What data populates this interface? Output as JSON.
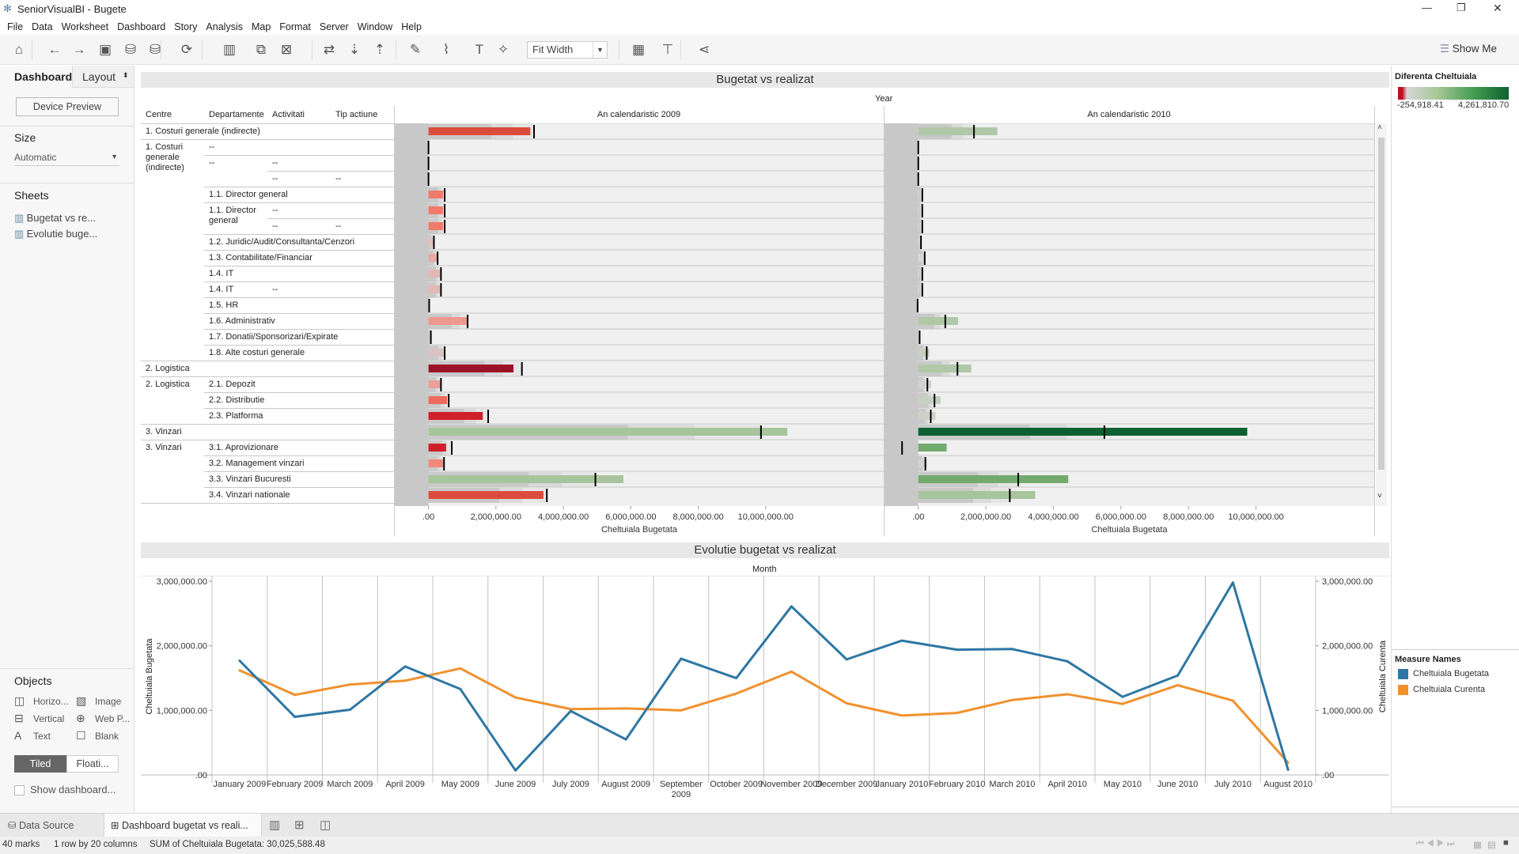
{
  "window": {
    "title": "SeniorVisualBI - Bugete",
    "controls": [
      "—",
      "❐",
      "✕"
    ]
  },
  "menu": [
    "File",
    "Data",
    "Worksheet",
    "Dashboard",
    "Story",
    "Analysis",
    "Map",
    "Format",
    "Server",
    "Window",
    "Help"
  ],
  "toolbar": {
    "icons": [
      {
        "name": "home-icon",
        "glyph": "⌂"
      },
      {
        "name": "undo-icon",
        "glyph": "←"
      },
      {
        "name": "redo-icon",
        "glyph": "→"
      },
      {
        "name": "save-icon",
        "glyph": "▣"
      },
      {
        "name": "new-datasource-icon",
        "glyph": "⛁"
      },
      {
        "name": "pause-updates-icon",
        "glyph": "⛁"
      },
      {
        "name": "refresh-icon",
        "glyph": "⟳"
      },
      {
        "name": "new-worksheet-icon",
        "glyph": "▥"
      },
      {
        "name": "duplicate-sheet-icon",
        "glyph": "⧉"
      },
      {
        "name": "clear-sheet-icon",
        "glyph": "⊠"
      },
      {
        "name": "swap-icon",
        "glyph": "⇄"
      },
      {
        "name": "sort-ascending-icon",
        "glyph": "⇣"
      },
      {
        "name": "sort-descending-icon",
        "glyph": "⇡"
      },
      {
        "name": "highlight-icon",
        "glyph": "✎"
      },
      {
        "name": "group-icon",
        "glyph": "⌇"
      },
      {
        "name": "labels-icon",
        "glyph": "T"
      },
      {
        "name": "pin-icon",
        "glyph": "✧"
      },
      {
        "name": "show-cards-icon",
        "glyph": "▦"
      },
      {
        "name": "presentation-icon",
        "glyph": "⊤"
      },
      {
        "name": "share-icon",
        "glyph": "⋖"
      }
    ],
    "fit": "Fit Width",
    "show_me": "Show Me"
  },
  "left_pane": {
    "tabs": [
      "Dashboard",
      "Layout"
    ],
    "device_preview": "Device Preview",
    "size_label": "Size",
    "size_value": "Automatic",
    "sheets_label": "Sheets",
    "sheets": [
      "Bugetat vs re...",
      "Evolutie buge..."
    ],
    "objects_label": "Objects",
    "objects": [
      {
        "icon": "horizontal-icon",
        "glyph": "◫",
        "label": "Horizo..."
      },
      {
        "icon": "image-icon",
        "glyph": "▨",
        "label": "Image"
      },
      {
        "icon": "vertical-icon",
        "glyph": "⊟",
        "label": "Vertical"
      },
      {
        "icon": "web-page-icon",
        "glyph": "⊕",
        "label": "Web P..."
      },
      {
        "icon": "text-icon",
        "glyph": "A",
        "label": "Text"
      },
      {
        "icon": "blank-icon",
        "glyph": "☐",
        "label": "Blank"
      }
    ],
    "tiled": "Tiled",
    "floating": "Floati...",
    "show_dashboard": "Show dashboard..."
  },
  "sheet1": {
    "title": "Bugetat vs realizat",
    "year_label": "Year",
    "headers": [
      "Centre",
      "Departamente",
      "Activitati",
      "Tip actiune"
    ],
    "years": [
      "An calendaristic 2009",
      "An calendaristic 2010"
    ],
    "axis_title": "Cheltuiala Bugetata",
    "ticks": [
      ".00",
      "2,000,000.00",
      "4,000,000.00",
      "6,000,000.00",
      "8,000,000.00",
      "10,000,000.00"
    ]
  },
  "chart_data": [
    {
      "type": "bar",
      "subtype": "bullet",
      "title": "Bugetat vs realizat",
      "xlabel": "Cheltuiala Bugetata",
      "xlim": [
        -1000000,
        13500000
      ],
      "tick_values": [
        0,
        2000000,
        4000000,
        6000000,
        8000000,
        10000000
      ],
      "rows": [
        {
          "centre": "1. Costuri generale (indirecte)",
          "dep": "",
          "act": "",
          "tip": "",
          "y2009": {
            "v": 3020000,
            "ref": 3130000,
            "c": "#dc4c3c"
          },
          "y2010": {
            "v": 2340000,
            "ref": 1650000,
            "c": "#b0c8a8"
          }
        },
        {
          "centre": "1. Costuri generale (indirecte)",
          "dep": "--",
          "act": "",
          "tip": "",
          "y2009": {
            "v": 0,
            "ref": 0,
            "c": "#d8d8d8"
          },
          "y2010": {
            "v": 0,
            "ref": 0,
            "c": "#d8d8d8"
          }
        },
        {
          "centre": "",
          "dep": "--",
          "act": "--",
          "tip": "",
          "y2009": {
            "v": 0,
            "ref": 0,
            "c": "#d8d8d8"
          },
          "y2010": {
            "v": 0,
            "ref": 0,
            "c": "#d8d8d8"
          }
        },
        {
          "centre": "",
          "dep": "",
          "act": "--",
          "tip": "--",
          "y2009": {
            "v": 0,
            "ref": 0,
            "c": "#d8d8d8"
          },
          "y2010": {
            "v": 0,
            "ref": 0,
            "c": "#d8d8d8"
          }
        },
        {
          "centre": "",
          "dep": "1.1. Director general",
          "act": "",
          "tip": "",
          "y2009": {
            "v": 430000,
            "ref": 480000,
            "c": "#f07a6c"
          },
          "y2010": {
            "v": 20000,
            "ref": 120000,
            "c": "#d8d8d8"
          }
        },
        {
          "centre": "",
          "dep": "1.1. Director general",
          "act": "--",
          "tip": "",
          "y2009": {
            "v": 430000,
            "ref": 480000,
            "c": "#f07a6c"
          },
          "y2010": {
            "v": 20000,
            "ref": 120000,
            "c": "#d8d8d8"
          }
        },
        {
          "centre": "",
          "dep": "",
          "act": "--",
          "tip": "--",
          "y2009": {
            "v": 430000,
            "ref": 480000,
            "c": "#f07a6c"
          },
          "y2010": {
            "v": 20000,
            "ref": 120000,
            "c": "#d8d8d8"
          }
        },
        {
          "centre": "",
          "dep": "1.2. Juridic/Audit/Consultanta/Cenzori",
          "act": "",
          "tip": "",
          "y2009": {
            "v": 140000,
            "ref": 160000,
            "c": "#e4c0bd"
          },
          "y2010": {
            "v": 20000,
            "ref": 80000,
            "c": "#d8d8d8"
          }
        },
        {
          "centre": "",
          "dep": "1.3. Contabilitate/Financiar",
          "act": "",
          "tip": "",
          "y2009": {
            "v": 250000,
            "ref": 270000,
            "c": "#e8aaa5"
          },
          "y2010": {
            "v": 150000,
            "ref": 190000,
            "c": "#d8d8d8"
          }
        },
        {
          "centre": "",
          "dep": "1.4. IT",
          "act": "",
          "tip": "",
          "y2009": {
            "v": 350000,
            "ref": 370000,
            "c": "#e2b8b5"
          },
          "y2010": {
            "v": 30000,
            "ref": 120000,
            "c": "#d8d8d8"
          }
        },
        {
          "centre": "",
          "dep": "1.4. IT",
          "act": "--",
          "tip": "",
          "y2009": {
            "v": 350000,
            "ref": 370000,
            "c": "#e2b8b5"
          },
          "y2010": {
            "v": 30000,
            "ref": 120000,
            "c": "#d8d8d8"
          }
        },
        {
          "centre": "",
          "dep": "1.5. HR",
          "act": "",
          "tip": "",
          "y2009": {
            "v": 0,
            "ref": 20000,
            "c": "#d8d8d8"
          },
          "y2010": {
            "v": 0,
            "ref": -20000,
            "c": "#d8d8d8"
          }
        },
        {
          "centre": "",
          "dep": "1.6. Administrativ",
          "act": "",
          "tip": "",
          "y2009": {
            "v": 1140000,
            "ref": 1160000,
            "c": "#ee9890"
          },
          "y2010": {
            "v": 1180000,
            "ref": 800000,
            "c": "#b0c8a8"
          }
        },
        {
          "centre": "",
          "dep": "1.7. Donatii/Sponsorizari/Expirate",
          "act": "",
          "tip": "",
          "y2009": {
            "v": 0,
            "ref": 70000,
            "c": "#d8d8d8"
          },
          "y2010": {
            "v": 0,
            "ref": 40000,
            "c": "#d8d8d8"
          }
        },
        {
          "centre": "",
          "dep": "1.8. Alte costuri generale",
          "act": "",
          "tip": "",
          "y2009": {
            "v": 470000,
            "ref": 480000,
            "c": "#d9c4c2"
          },
          "y2010": {
            "v": 330000,
            "ref": 250000,
            "c": "#c8d0c4"
          }
        },
        {
          "centre": "2. Logistica",
          "dep": "",
          "act": "",
          "tip": "",
          "y2009": {
            "v": 2520000,
            "ref": 2770000,
            "c": "#9b1228"
          },
          "y2010": {
            "v": 1570000,
            "ref": 1160000,
            "c": "#b0c8a8"
          }
        },
        {
          "centre": "2. Logistica",
          "dep": "2.1. Depozit",
          "act": "",
          "tip": "",
          "y2009": {
            "v": 350000,
            "ref": 370000,
            "c": "#eaa09a"
          },
          "y2010": {
            "v": 380000,
            "ref": 270000,
            "c": "#cfd3cc"
          }
        },
        {
          "centre": "",
          "dep": "2.2. Distributie",
          "act": "",
          "tip": "",
          "y2009": {
            "v": 550000,
            "ref": 600000,
            "c": "#ee6a5c"
          },
          "y2010": {
            "v": 660000,
            "ref": 480000,
            "c": "#c7d1c3"
          }
        },
        {
          "centre": "",
          "dep": "2.3. Platforma",
          "act": "",
          "tip": "",
          "y2009": {
            "v": 1610000,
            "ref": 1770000,
            "c": "#d0202a"
          },
          "y2010": {
            "v": 510000,
            "ref": 370000,
            "c": "#ccd2c8"
          }
        },
        {
          "centre": "3. Vinzari",
          "dep": "",
          "act": "",
          "tip": "",
          "y2009": {
            "v": 10640000,
            "ref": 9860000,
            "c": "#a8c49c"
          },
          "y2010": {
            "v": 9740000,
            "ref": 5510000,
            "c": "#0d6030"
          }
        },
        {
          "centre": "3. Vinzari",
          "dep": "3.1. Aprovizionare",
          "act": "",
          "tip": "",
          "y2009": {
            "v": 520000,
            "ref": 690000,
            "c": "#d0202a"
          },
          "y2010": {
            "v": 840000,
            "ref": -480000,
            "c": "#72ab6e"
          }
        },
        {
          "centre": "",
          "dep": "3.2. Management vinzari",
          "act": "",
          "tip": "",
          "y2009": {
            "v": 430000,
            "ref": 460000,
            "c": "#f2897c"
          },
          "y2010": {
            "v": 260000,
            "ref": 210000,
            "c": "#cfd3cc"
          }
        },
        {
          "centre": "",
          "dep": "3.3. Vinzari Bucuresti",
          "act": "",
          "tip": "",
          "y2009": {
            "v": 5780000,
            "ref": 4950000,
            "c": "#a8c49c"
          },
          "y2010": {
            "v": 4440000,
            "ref": 2960000,
            "c": "#72ab6e"
          }
        },
        {
          "centre": "",
          "dep": "3.4. Vinzari nationale",
          "act": "",
          "tip": "",
          "y2009": {
            "v": 3410000,
            "ref": 3510000,
            "c": "#dc4c3c"
          },
          "y2010": {
            "v": 3460000,
            "ref": 2710000,
            "c": "#a8c49c"
          }
        }
      ]
    },
    {
      "type": "line",
      "title": "Evolutie bugetat vs realizat",
      "xlabel": "Month",
      "ylabel_left": "Cheltuiala Bugetata",
      "ylabel_right": "Cheltuiala Curenta",
      "ylim": [
        0,
        3050000
      ],
      "y_ticks": [
        {
          "v": 0,
          "label": ".00"
        },
        {
          "v": 1000000,
          "label": "1,000,000.00"
        },
        {
          "v": 2000000,
          "label": "2,000,000.00"
        },
        {
          "v": 3000000,
          "label": "3,000,000.00"
        }
      ],
      "categories": [
        "January 2009",
        "February 2009",
        "March 2009",
        "April 2009",
        "May 2009",
        "June 2009",
        "July 2009",
        "August 2009",
        "September 2009",
        "October 2009",
        "November 2009",
        "December 2009",
        "January 2010",
        "February 2010",
        "March 2010",
        "April 2010",
        "May 2010",
        "June 2010",
        "July 2010",
        "August 2010"
      ],
      "series": [
        {
          "name": "Cheltuiala Bugetata",
          "color": "#2e77a4",
          "values": [
            1770000,
            900000,
            1010000,
            1680000,
            1330000,
            70000,
            990000,
            550000,
            1800000,
            1500000,
            2610000,
            1790000,
            2080000,
            1940000,
            1950000,
            1760000,
            1210000,
            1540000,
            2980000,
            80000
          ]
        },
        {
          "name": "Cheltuiala Curenta",
          "color": "#f0912e",
          "values": [
            1620000,
            1240000,
            1400000,
            1460000,
            1650000,
            1200000,
            1020000,
            1030000,
            1000000,
            1260000,
            1600000,
            1110000,
            920000,
            960000,
            1160000,
            1250000,
            1100000,
            1390000,
            1150000,
            190000
          ]
        }
      ],
      "grid": "vertical"
    }
  ],
  "legend": {
    "diff_title": "Diferenta Cheltuiala",
    "diff_min": "-254,918.41",
    "diff_max": "4,261,810.70",
    "colors": {
      "neg": "#c0101e",
      "mid": "#d6d6d6",
      "pos": "#0d6030"
    },
    "measure_title": "Measure Names",
    "measures": [
      {
        "name": "Cheltuiala Bugetata",
        "color": "#2e77a4"
      },
      {
        "name": "Cheltuiala Curenta",
        "color": "#f0912e"
      }
    ]
  },
  "tabs": {
    "data_source": "Data Source",
    "dashboard": "Dashboard bugetat vs reali..."
  },
  "status": {
    "marks": "40 marks",
    "dims": "1 row by 20 columns",
    "sum": "SUM of Cheltuiala Bugetata: 30,025,588.48"
  }
}
